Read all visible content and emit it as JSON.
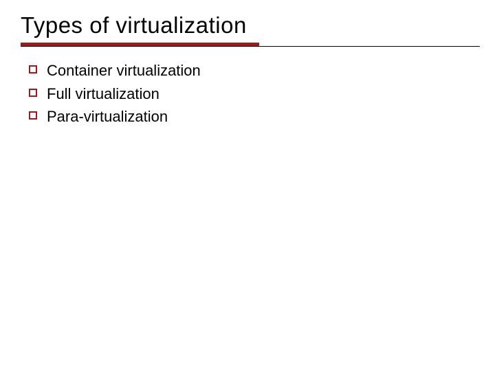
{
  "title": "Types of virtualization",
  "bullets": [
    "Container virtualization",
    "Full virtualization",
    "Para-virtualization"
  ],
  "colors": {
    "accent": "#a01818",
    "text": "#000000"
  }
}
